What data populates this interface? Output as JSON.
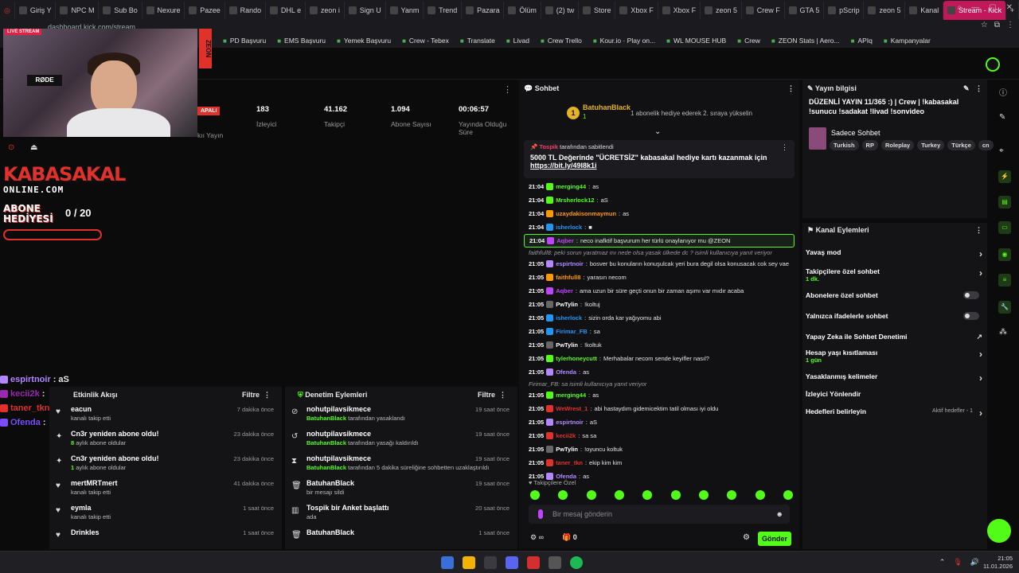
{
  "browser": {
    "tabs": [
      "Giriş Y",
      "NPC M",
      "Sub Bo",
      "Nexure",
      "Pazee",
      "Rando",
      "DHL e",
      "zeon i",
      "Sign U",
      "Yanm",
      "Trend",
      "Pazara",
      "Ölüm",
      "(2) tw",
      "Store",
      "Xbox F",
      "Xbox F",
      "zeon 5",
      "Crew F",
      "GTA 5",
      "pScrip",
      "zeon 5",
      "Kanal",
      "Stream - Kick"
    ],
    "active_tab": "Stream - Kick",
    "url": "dashboard.kick.com/stream",
    "bookmarks": [
      "PD Başvuru",
      "EMS Başvuru",
      "Yemek Başvuru",
      "Crew - Tebex",
      "Translate",
      "Livad",
      "Crew Trello",
      "Kour.io · Play on...",
      "WL MOUSE HUB",
      "Crew",
      "ZEON Stats | Aero...",
      "APIq",
      "Kampanyalar"
    ]
  },
  "stream": {
    "live_label": "LIVE STREAM",
    "mic_brand": "RØDE",
    "sponsor": "ZEON",
    "status_pill": "APALI",
    "stats": [
      {
        "value": "183",
        "label": "İzleyici"
      },
      {
        "value": "41.162",
        "label": "Takipçi"
      },
      {
        "value": "1.094",
        "label": "Abone Sayısı"
      },
      {
        "value": "00:06:57",
        "label": "Yayında Olduğu Süre"
      }
    ],
    "stat_cut_label": "kıı Yayın"
  },
  "overlay": {
    "brand_top": "KABASAKAL",
    "brand_bottom": "ONLINE.COM",
    "goal_title": "ABONE HEDİYESİ",
    "goal_count": "0 / 20",
    "chat": [
      {
        "user": "espirtnoir",
        "text": "aS",
        "color": "#b388ff"
      },
      {
        "user": "kecii2k",
        "text": "",
        "color": "#9c27b0"
      },
      {
        "user": "taner_tkn",
        "text": "ekip kim kim",
        "color": "#e0312b"
      },
      {
        "user": "Ofenda",
        "text": "",
        "color": "#7c4dff"
      }
    ]
  },
  "activity": {
    "title": "Etkinlik Akışı",
    "filter": "Filtre",
    "items": [
      {
        "name": "eacun",
        "sub": "kanalı takip etti",
        "time": "7 dakika önce",
        "icon": "♥"
      },
      {
        "name": "Cn3r yeniden abone oldu!",
        "sub_num": "8",
        "sub": "aylık abone oldular",
        "time": "23 dakika önce",
        "icon": "✦"
      },
      {
        "name": "Cn3r yeniden abone oldu!",
        "sub_num": "1",
        "sub": "aylık abone oldular",
        "time": "23 dakika önce",
        "icon": "✦"
      },
      {
        "name": "mertMRTmert",
        "sub": "kanalı takip etti",
        "time": "41 dakika önce",
        "icon": "♥"
      },
      {
        "name": "eymla",
        "sub": "kanalı takip etti",
        "time": "1 saat önce",
        "icon": "♥"
      },
      {
        "name": "Drinkles",
        "sub": "",
        "time": "1 saat önce",
        "icon": "♥"
      }
    ]
  },
  "moderation": {
    "title": "Denetim Eylemleri",
    "filter": "Filtre",
    "items": [
      {
        "name": "nohutpilavsikmece",
        "who": "BatuhanBlack",
        "sub": "tarafından yasaklandı",
        "time": "19 saat önce",
        "icon": "⊘"
      },
      {
        "name": "nohutpilavsikmece",
        "who": "BatuhanBlack",
        "sub": "tarafından yasağı kaldırıldı",
        "time": "19 saat önce",
        "icon": "↺"
      },
      {
        "name": "nohutpilavsikmece",
        "who": "BatuhanBlack",
        "sub": "tarafından 5 dakika süreliğine sohbetten uzaklaştırıldı",
        "time": "19 saat önce",
        "icon": "⧗"
      },
      {
        "name": "BatuhanBlack",
        "who": "",
        "sub": "bir mesajı sildi",
        "time": "19 saat önce",
        "icon": "🗑"
      },
      {
        "name": "Tospik bir Anket başlattı",
        "who": "",
        "sub": "ada",
        "time": "20 saat önce",
        "icon": "▥"
      },
      {
        "name": "BatuhanBlack",
        "who": "",
        "sub": "",
        "time": "1 saat önce",
        "icon": "🗑"
      }
    ]
  },
  "chat": {
    "title": "Sohbet",
    "gifter_rank": "1",
    "gifter_name": "BatuhanBlack",
    "gifter_count": "1",
    "gifter_msg": "1 abonelik hediye ederek 2. sıraya yükselin",
    "pinned_by": "Tospik",
    "pinned_suffix": "tarafından sabitlendi",
    "pinned_text": "5000 TL Değerinde \"ÜCRETSİZ\" kabasakal hediye kartı kazanmak için",
    "pinned_link": "https://bit.ly/49I8k1i",
    "messages": [
      {
        "time": "21:04",
        "user": "merging44",
        "color": "#53fc18",
        "text": "as"
      },
      {
        "time": "21:04",
        "user": "Mrsherlock12",
        "color": "#53fc18",
        "text": "aS"
      },
      {
        "time": "21:04",
        "user": "uzaydakisonmaymun",
        "color": "#ff9800",
        "text": "as"
      },
      {
        "time": "21:04",
        "user": "isherlock",
        "color": "#2196f3",
        "text": "■"
      },
      {
        "time": "21:04",
        "user": "Aqber",
        "color": "#c043ff",
        "text": "neco inafktif başvurum her türlü onaylanıyor mu @ZEON",
        "hl": true
      },
      {
        "reply": "faithfull8: peki sorun yaratmaz mı nede olsa yasak ülkede dc ? isimli kullanıcıya yanıt veriyor"
      },
      {
        "time": "21:05",
        "user": "espirtnoir",
        "color": "#b388ff",
        "text": "bosver bu konuların konuşulcak yeri bura degil olsa konusacak cok sey vae"
      },
      {
        "time": "21:05",
        "user": "faithfull8",
        "color": "#ff9800",
        "text": "yarasın necom"
      },
      {
        "time": "21:05",
        "user": "Aqber",
        "color": "#c043ff",
        "text": "ama uzun bir süre geçti onun bir zaman aşımı var mıdır acaba"
      },
      {
        "time": "21:05",
        "user": "PwTylin",
        "color": "#ffffff",
        "text": "!koltuj"
      },
      {
        "time": "21:05",
        "user": "isherlock",
        "color": "#2196f3",
        "text": "sizin orda kar yağıyomu abi"
      },
      {
        "time": "21:05",
        "user": "Firimar_FB",
        "color": "#2196f3",
        "text": "sa"
      },
      {
        "time": "21:05",
        "user": "PwTylin",
        "color": "#ffffff",
        "text": "!koltuk"
      },
      {
        "time": "21:05",
        "user": "tylerhoneycutt",
        "color": "#53fc18",
        "text": "Merhabalar necom sende keyifler nasıl?"
      },
      {
        "time": "21:05",
        "user": "Ofenda",
        "color": "#b388ff",
        "text": "as"
      },
      {
        "reply": "Firimar_FB: sa isimli kullanıcıya yanıt veriyor"
      },
      {
        "time": "21:05",
        "user": "merging44",
        "color": "#53fc18",
        "text": "as"
      },
      {
        "time": "21:05",
        "user": "WeWrest_1",
        "color": "#e0312b",
        "text": "abi hastaydım gidemicektim tatil olması iyi oldu"
      },
      {
        "time": "21:05",
        "user": "espirtnoir",
        "color": "#b388ff",
        "text": "aS"
      },
      {
        "time": "21:05",
        "user": "kecii2k",
        "color": "#e0312b",
        "text": "sa sa"
      },
      {
        "time": "21:05",
        "user": "PwTylin",
        "color": "#ffffff",
        "text": "!oyuncu koltuk"
      },
      {
        "time": "21:05",
        "user": "taner_tkn",
        "color": "#e0312b",
        "text": "ekip kim kim"
      },
      {
        "time": "21:05",
        "user": "Ofenda",
        "color": "#b388ff",
        "text": "as"
      }
    ],
    "follower_tag": "Takipçilere Özel",
    "input_placeholder": "Bir mesaj gönderin",
    "infinite": "∞",
    "count": "0",
    "send": "Gönder"
  },
  "info": {
    "title": "Yayın bilgisi",
    "stream_title": "DÜZENLİ YAYIN 11/365 :) | Crew | !kabasakal !sunucu !sadakat !livad !sonvideo",
    "category": "Sadece Sohbet",
    "tags": [
      "Turkish",
      "RP",
      "Roleplay",
      "Turkey",
      "Türkçe",
      "cn"
    ]
  },
  "channel_actions": {
    "title": "Kanal Eylemleri",
    "items": [
      {
        "label": "Yavaş mod",
        "kind": "chev"
      },
      {
        "label": "Takipçilere özel sohbet",
        "sub": "1 dk.",
        "kind": "chev"
      },
      {
        "label": "Abonelere özel sohbet",
        "kind": "toggle"
      },
      {
        "label": "Yalnızca ifadelerle sohbet",
        "kind": "toggle"
      },
      {
        "label": "Yapay Zeka ile Sohbet Denetimi",
        "kind": "ext"
      },
      {
        "label": "Hesap yaşı kısıtlaması",
        "sub": "1 gün",
        "kind": "chev"
      },
      {
        "label": "Yasaklanmış kelimeler",
        "kind": "chev"
      },
      {
        "label": "İzleyici Yönlendir",
        "kind": "none"
      },
      {
        "label": "Hedefleri belirleyin",
        "right": "Aktif hedefler - 1",
        "kind": "chev"
      }
    ]
  },
  "taskbar": {
    "time": "21:05",
    "date": "11.01.2026"
  },
  "colors": {
    "accent": "#53fc18",
    "brand_red": "#e0312b"
  }
}
